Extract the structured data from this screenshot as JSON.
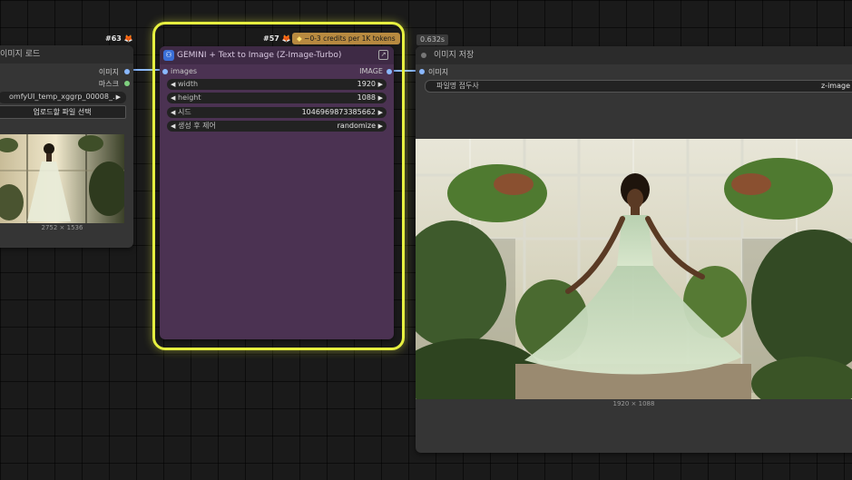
{
  "load_node": {
    "title": "이미지 로드",
    "id": "#63",
    "outputs": [
      "이미지",
      "마스크"
    ],
    "filename": "omfyUI_temp_xggrp_00008_.",
    "upload_button": "업로드할 파일 선택",
    "dims": "2752 × 1536"
  },
  "gemini_node": {
    "id": "#57",
    "credits": "~0-3 credits per 1K tokens",
    "title": "GEMINI + Text to Image (Z-Image-Turbo)",
    "input_label": "images",
    "output_label": "IMAGE",
    "widgets": [
      {
        "label": "width",
        "value": "1920"
      },
      {
        "label": "height",
        "value": "1088"
      },
      {
        "label": "시드",
        "value": "1046969873385662"
      },
      {
        "label": "생성 후 제어",
        "value": "randomize"
      }
    ]
  },
  "save_node": {
    "timing": "0.632s",
    "title": "이미지 저장",
    "input_label": "이미지",
    "prefix_label": "파일명 접두사",
    "prefix_value": "z-image",
    "dims": "1920 × 1088"
  },
  "colors": {
    "selection": "#e6f040",
    "node_purple": "#4b3252",
    "wire": "#8ab8ff"
  }
}
